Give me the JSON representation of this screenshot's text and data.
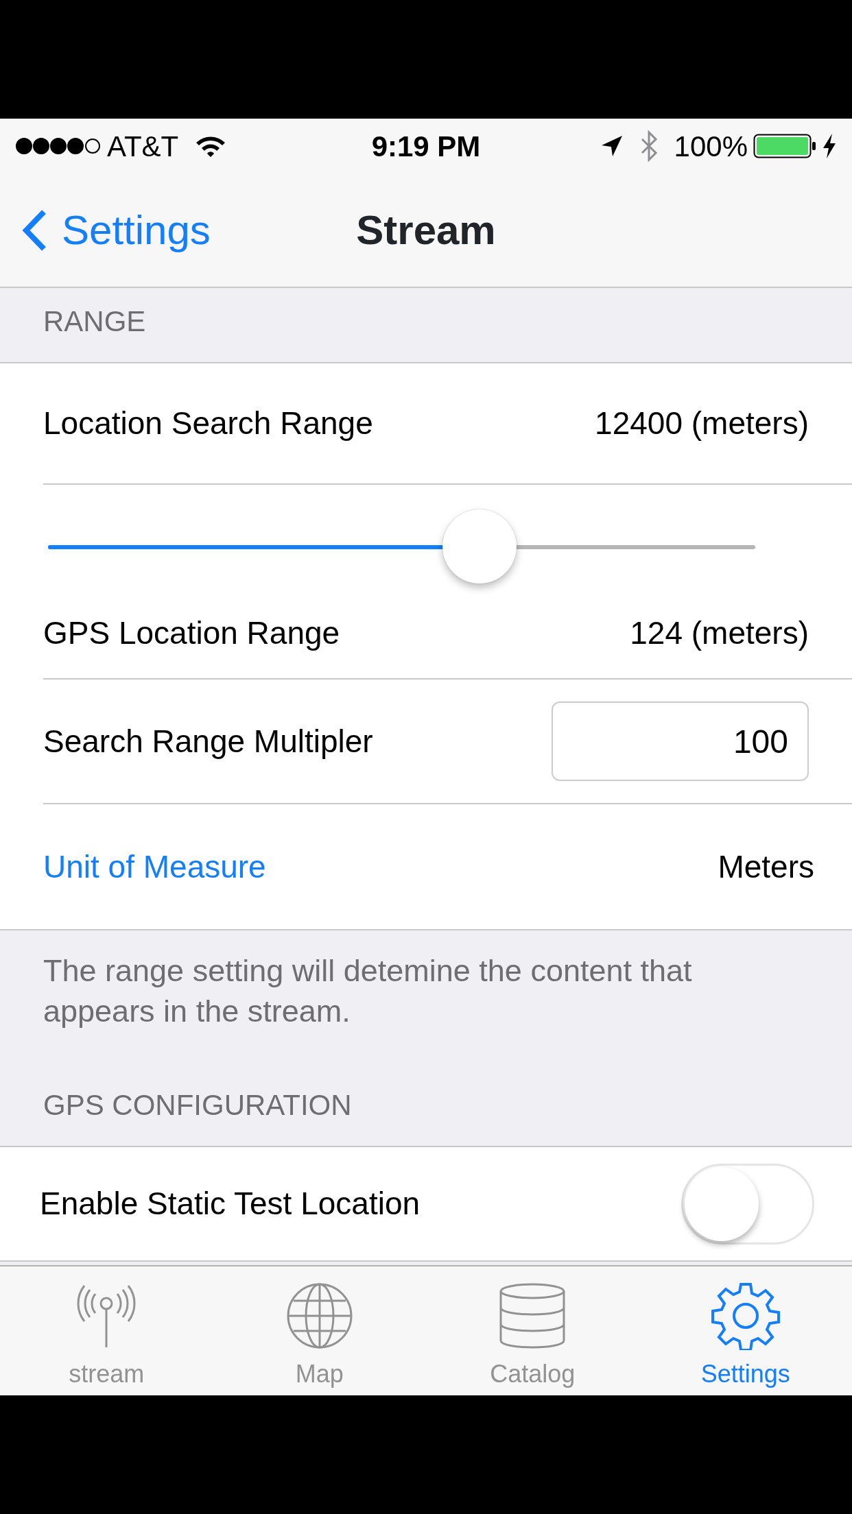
{
  "status_bar": {
    "carrier": "AT&T",
    "time": "9:19 PM",
    "battery": "100%"
  },
  "nav": {
    "back": "Settings",
    "title": "Stream"
  },
  "sections": [
    {
      "header": "RANGE",
      "rows": [
        {
          "kind": "value",
          "label": "Location Search Range",
          "value": "12400 (meters)"
        },
        {
          "kind": "slider",
          "level": 0.61
        },
        {
          "kind": "value",
          "label": "GPS Location Range",
          "value": "124 (meters)"
        },
        {
          "kind": "input",
          "label": "Search Range Multipler",
          "value": "100"
        },
        {
          "kind": "link",
          "label": "Unit of Measure",
          "value": "Meters"
        }
      ],
      "footer": "The range setting will detemine the content that appears in the stream."
    },
    {
      "header": "GPS CONFIGURATION",
      "rows": [
        {
          "kind": "toggle",
          "label": "Enable Static Test Location",
          "on": false
        }
      ]
    }
  ],
  "tabs": [
    {
      "label": "stream",
      "selected": false
    },
    {
      "label": "Map",
      "selected": false
    },
    {
      "label": "Catalog",
      "selected": false
    },
    {
      "label": "Settings",
      "selected": true
    }
  ]
}
